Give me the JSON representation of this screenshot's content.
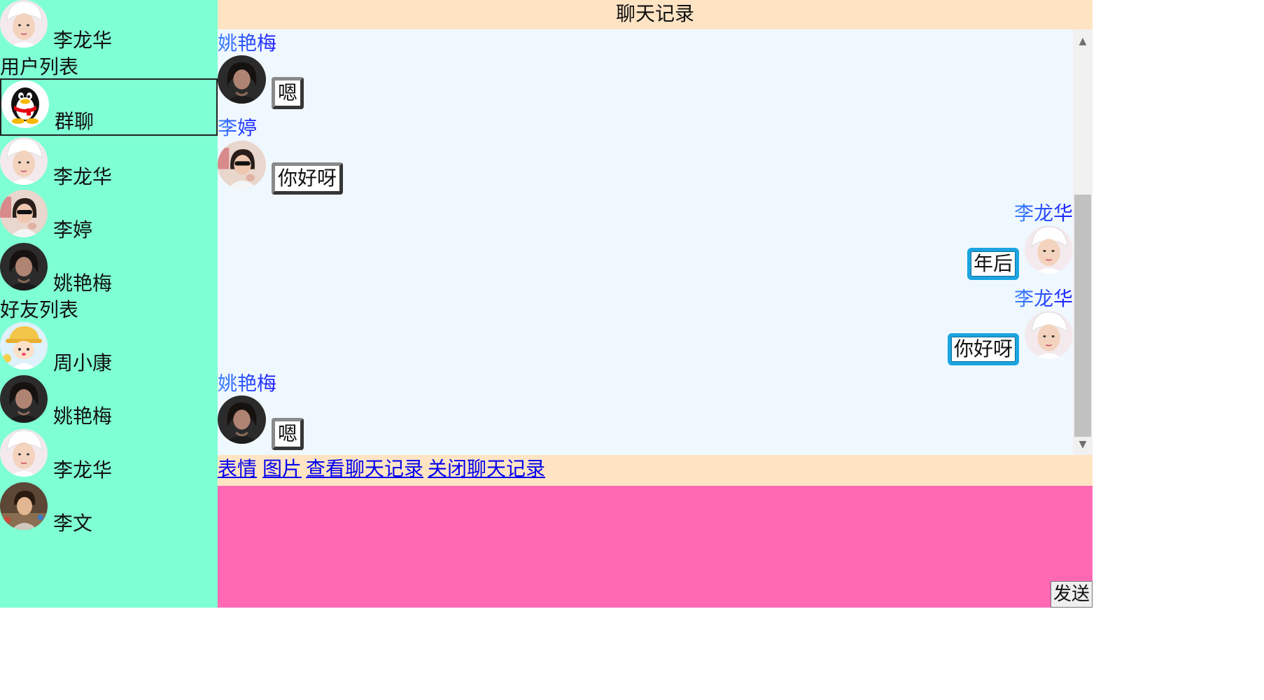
{
  "sidebar": {
    "current_user": {
      "name": "李龙华",
      "avatar": "boy-white-hat-avatar"
    },
    "user_list_label": "用户列表",
    "user_list": [
      {
        "name": "群聊",
        "avatar": "qq-penguin-avatar",
        "selected": true
      },
      {
        "name": "李龙华",
        "avatar": "boy-white-hat-avatar"
      },
      {
        "name": "李婷",
        "avatar": "girl-sunglasses-avatar"
      },
      {
        "name": "姚艳梅",
        "avatar": "woman-dark-avatar"
      }
    ],
    "friend_list_label": "好友列表",
    "friend_list": [
      {
        "name": "周小康",
        "avatar": "cartoon-kid-avatar"
      },
      {
        "name": "姚艳梅",
        "avatar": "woman-dark-avatar"
      },
      {
        "name": "李龙华",
        "avatar": "boy-white-hat-avatar"
      },
      {
        "name": "李文",
        "avatar": "child-photo-avatar"
      }
    ]
  },
  "chat": {
    "title": "聊天记录",
    "messages": [
      {
        "sender": "姚艳梅",
        "text": "嗯",
        "direction": "in"
      },
      {
        "sender": "李婷",
        "text": "你好呀",
        "direction": "in"
      },
      {
        "sender": "李龙华",
        "text": "年后",
        "direction": "out"
      },
      {
        "sender": "李龙华",
        "text": "你好呀",
        "direction": "out"
      },
      {
        "sender": "姚艳梅",
        "text": "嗯",
        "direction": "in"
      }
    ]
  },
  "toolbar": {
    "emoji": "表情",
    "image": "图片",
    "view_history": "查看聊天记录",
    "close_history": "关闭聊天记录"
  },
  "composer": {
    "send_label": "发送"
  },
  "colors": {
    "sidebar_bg": "#7fffd4",
    "header_bg": "#ffe4c4",
    "messages_bg": "#f0f8ff",
    "composer_bg": "#ff69b4",
    "outgoing_border": "#1ba5e0",
    "sender_name": "#3b86ff"
  }
}
